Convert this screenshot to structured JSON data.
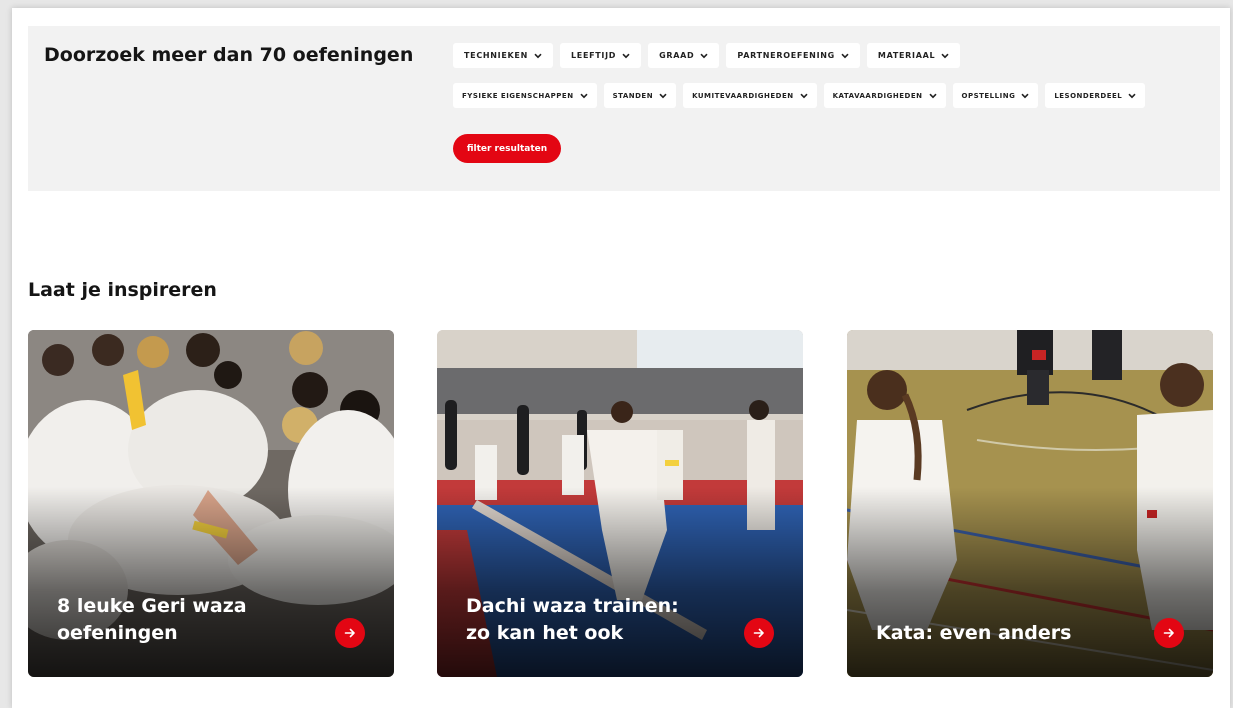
{
  "filters": {
    "title": "Doorzoek meer dan 70 oefeningen",
    "row1": [
      "TECHNIEKEN",
      "LEEFTIJD",
      "GRAAD",
      "PARTNEROEFENING",
      "MATERIAAL"
    ],
    "row2": [
      "FYSIEKE EIGENSCHAPPEN",
      "STANDEN",
      "KUMITEVAARDIGHEDEN",
      "KATAVAARDIGHEDEN",
      "OPSTELLING",
      "LESONDERDEEL"
    ],
    "submit_label": "filter resultaten",
    "chevron_icon": "chevron-down-icon"
  },
  "inspiration": {
    "title": "Laat je inspireren",
    "cards": [
      {
        "title": "8 leuke Geri waza oefeningen",
        "icon": "arrow-right-icon"
      },
      {
        "title": "Dachi waza trainen: zo kan het ook",
        "icon": "arrow-right-icon"
      },
      {
        "title": "Kata: even anders",
        "icon": "arrow-right-icon"
      }
    ]
  },
  "colors": {
    "accent": "#e30613",
    "panel": "#f2f2f2",
    "text": "#151515"
  }
}
